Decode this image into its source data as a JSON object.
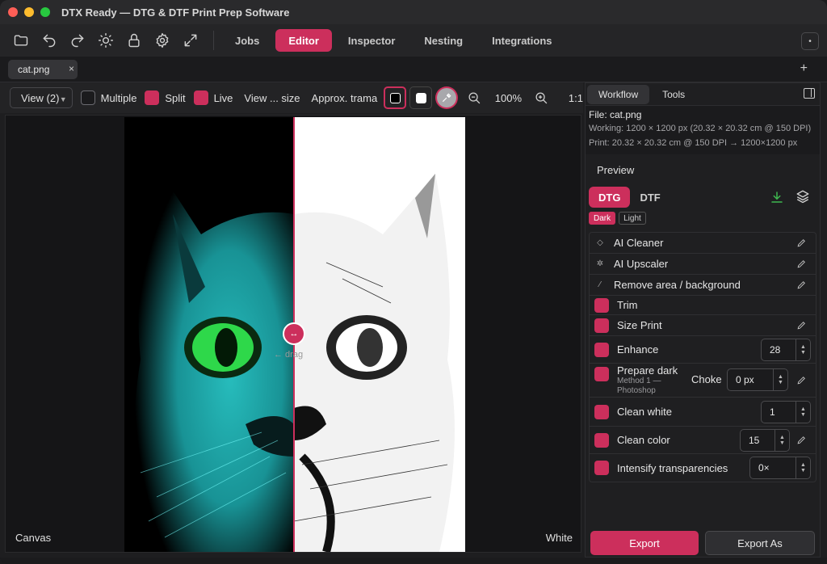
{
  "window": {
    "title": "DTX Ready — DTG & DTF Print Prep Software"
  },
  "toolbar": {
    "icons": [
      "folder-icon",
      "undo-icon",
      "redo-icon",
      "brightness-icon",
      "lock-icon",
      "gear-icon",
      "expand-icon"
    ],
    "tabs": [
      {
        "label": "Jobs",
        "active": false
      },
      {
        "label": "Editor",
        "active": true
      },
      {
        "label": "Inspector",
        "active": false
      },
      {
        "label": "Nesting",
        "active": false
      },
      {
        "label": "Integrations",
        "active": false
      }
    ],
    "more_label": "•"
  },
  "file_tabs": [
    {
      "name": "cat.png",
      "close": "×"
    }
  ],
  "new_tab_label": "+",
  "view_controls": {
    "view_select": "View (2)",
    "multiple_label": "Multiple",
    "multiple_checked": false,
    "split_label": "Split",
    "split_checked": true,
    "live_label": "Live",
    "live_checked": true,
    "view_size_label": "View ... size",
    "approx_label": "Approx. trama",
    "zoom_value": "100%",
    "one_to_one": "1:1"
  },
  "canvas": {
    "left_label": "Canvas",
    "right_label": "White",
    "drag_hint": "← drag",
    "split_fraction": 0.5
  },
  "panel": {
    "tabs": [
      {
        "label": "Workflow",
        "active": true
      },
      {
        "label": "Tools",
        "active": false
      }
    ],
    "file_label": "File: cat.png",
    "working": "Working: 1200 × 1200 px (20.32 × 20.32 cm @ 150 DPI)",
    "print": "Print: 20.32 × 20.32 cm @ 150 DPI → 1200×1200 px",
    "preview_label": "Preview",
    "modes": [
      {
        "label": "DTG",
        "active": true
      },
      {
        "label": "DTF",
        "active": false
      }
    ],
    "subtabs": [
      {
        "label": "Dark",
        "active": true
      },
      {
        "label": "Light",
        "active": false
      }
    ],
    "steps": {
      "ai_cleaner": "AI Cleaner",
      "ai_upscaler": "AI Upscaler",
      "remove_bg": "Remove area / background",
      "trim": "Trim",
      "size_print": "Size Print",
      "enhance": "Enhance",
      "enhance_value": "28",
      "prepare_dark": "Prepare dark",
      "prepare_dark_sub": "Method 1 —",
      "prepare_dark_sub2": "Photoshop",
      "choke_label": "Choke",
      "choke_value": "0 px",
      "clean_white": "Clean white",
      "clean_white_value": "1",
      "clean_color": "Clean color",
      "clean_color_value": "15",
      "intensify": "Intensify transparencies",
      "intensify_value": "0×"
    },
    "export_label": "Export",
    "export_as_label": "Export As"
  },
  "colors": {
    "accent": "#cc2f5c",
    "background": "#1e1e20",
    "panel": "#1f1f21"
  }
}
